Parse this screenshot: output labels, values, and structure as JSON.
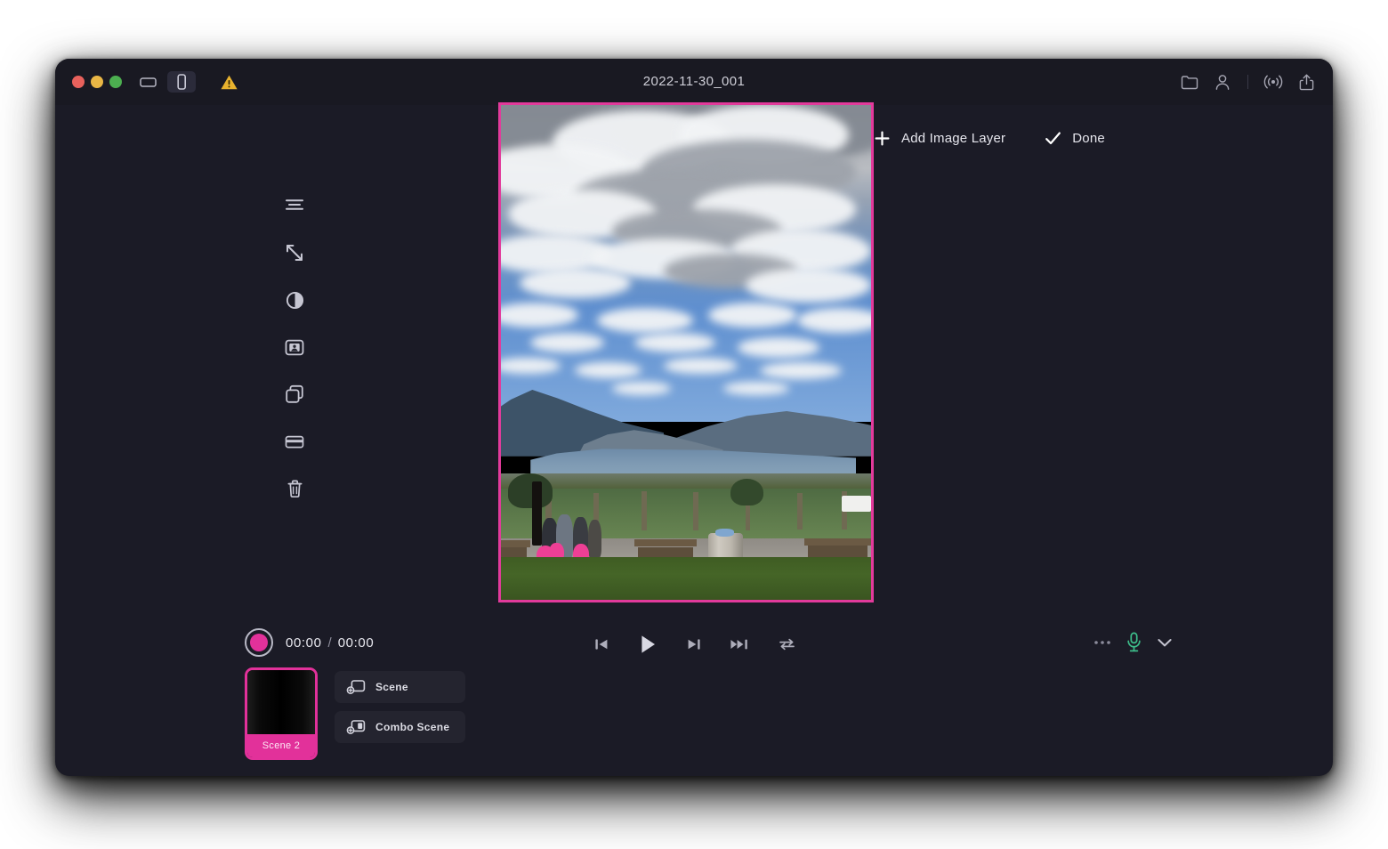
{
  "window": {
    "title": "2022-11-30_001",
    "traffic_lights": [
      {
        "name": "close",
        "color": "#e8615c"
      },
      {
        "name": "minimize",
        "color": "#e9b645"
      },
      {
        "name": "maximize",
        "color": "#4caf50"
      }
    ],
    "orientation_controls": [
      {
        "icon": "landscape-orientation-icon",
        "active": false
      },
      {
        "icon": "portrait-orientation-icon",
        "active": true
      }
    ],
    "warning_icon": "warning-triangle-icon",
    "right_icons": [
      "folder-icon",
      "person-icon",
      "broadcast-icon",
      "share-icon"
    ]
  },
  "tool_rail": {
    "items": [
      {
        "icon": "text-align-icon",
        "label": "Align"
      },
      {
        "icon": "resize-diagonal-icon",
        "label": "Resize"
      },
      {
        "icon": "contrast-icon",
        "label": "Contrast"
      },
      {
        "icon": "image-frame-icon",
        "label": "Image"
      },
      {
        "icon": "duplicate-layers-icon",
        "label": "Duplicate"
      },
      {
        "icon": "card-crop-icon",
        "label": "Crop"
      },
      {
        "icon": "trash-icon",
        "label": "Delete"
      }
    ]
  },
  "canvas": {
    "border_color": "#e23a9b",
    "actions": [
      {
        "icon": "plus-icon",
        "label": "Add Image Layer"
      },
      {
        "icon": "checkmark-icon",
        "label": "Done"
      }
    ]
  },
  "transport": {
    "record": {
      "icon": "record-icon",
      "color": "#e2319a"
    },
    "current_time": "00:00",
    "separator": "/",
    "total_time": "00:00",
    "playback_buttons": [
      {
        "icon": "skip-previous-icon",
        "label": "Previous"
      },
      {
        "icon": "play-icon",
        "label": "Play"
      },
      {
        "icon": "skip-next-icon",
        "label": "Next"
      },
      {
        "icon": "fast-forward-icon",
        "label": "Fast Forward"
      },
      {
        "icon": "loop-icon",
        "label": "Loop"
      }
    ],
    "audio": {
      "more_icon": "more-horizontal-icon",
      "mic_icon": "microphone-icon",
      "mic_color": "#3dbd8a",
      "chevron_icon": "chevron-down-icon"
    }
  },
  "scenes": {
    "selected_color": "#e2319a",
    "thumbnail": {
      "label": "Scene 2",
      "selected": true
    },
    "buttons": [
      {
        "icon": "add-scene-icon",
        "label": "Scene"
      },
      {
        "icon": "add-combo-scene-icon",
        "label": "Combo Scene"
      }
    ]
  }
}
